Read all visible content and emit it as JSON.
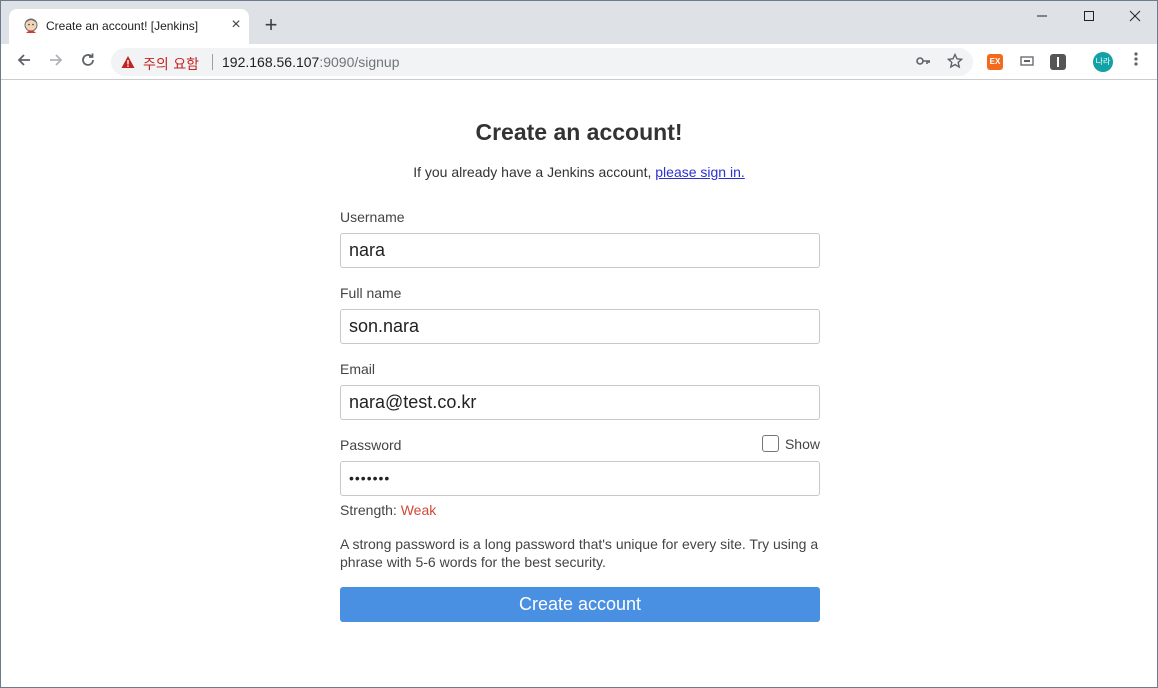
{
  "browser": {
    "tab_title": "Create an account! [Jenkins]",
    "tab_close": "×",
    "new_tab": "+",
    "security_warning": "주의 요함",
    "url_host": "192.168.56.107",
    "url_rest": ":9090/signup",
    "profile_initials": "나라",
    "extension_label": "EX"
  },
  "page": {
    "title": "Create an account!",
    "signin_prefix": "If you already have a Jenkins account, ",
    "signin_link": "please sign in."
  },
  "form": {
    "username_label": "Username",
    "username_value": "nara",
    "fullname_label": "Full name",
    "fullname_value": "son.nara",
    "email_label": "Email",
    "email_value": "nara@test.co.kr",
    "password_label": "Password",
    "password_masked": "•••••••",
    "show_label": "Show",
    "show_checked": false,
    "strength_label": "Strength: ",
    "strength_value": "Weak",
    "hint": "A strong password is a long password that's unique for every site. Try using a phrase with 5-6 words for the best security.",
    "submit_label": "Create account"
  },
  "colors": {
    "submit_bg": "#4a90e2",
    "weak": "#d24939",
    "link": "#2a32ce",
    "warning": "#c5221f"
  }
}
